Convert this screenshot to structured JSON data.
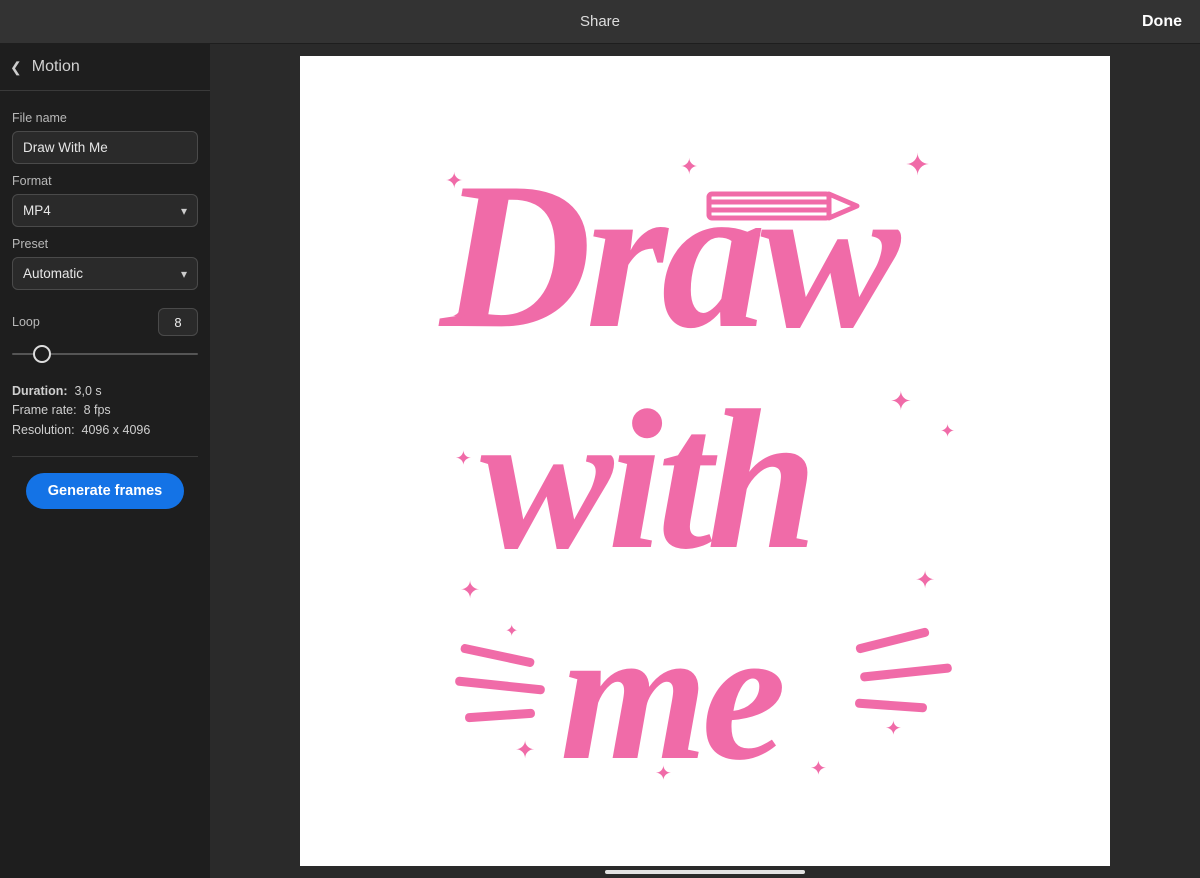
{
  "topbar": {
    "title": "Share",
    "done": "Done"
  },
  "panel": {
    "title": "Motion",
    "file_name_label": "File name",
    "file_name_value": "Draw With Me",
    "format_label": "Format",
    "format_value": "MP4",
    "preset_label": "Preset",
    "preset_value": "Automatic",
    "loop_label": "Loop",
    "loop_value": "8",
    "duration_label": "Duration:",
    "duration_value": "3,0 s",
    "framerate_label": "Frame rate:",
    "framerate_value": "8 fps",
    "resolution_label": "Resolution:",
    "resolution_value": "4096 x 4096",
    "generate_label": "Generate frames"
  },
  "artwork": {
    "line1": "Draw",
    "line2": "with",
    "line3": "me",
    "ink_color": "#f06ba8"
  }
}
